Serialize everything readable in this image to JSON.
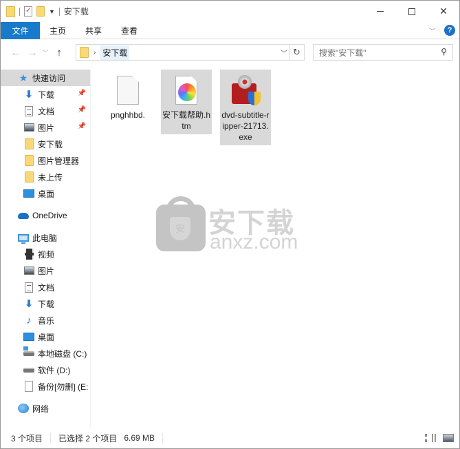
{
  "window": {
    "title": "安下载",
    "controls": [
      "minimize",
      "maximize",
      "close"
    ]
  },
  "ribbon": {
    "tabs": [
      {
        "label": "文件",
        "active": true
      },
      {
        "label": "主页"
      },
      {
        "label": "共享"
      },
      {
        "label": "查看"
      }
    ]
  },
  "navbar": {
    "breadcrumb": [
      "安下载"
    ],
    "search_placeholder": "搜索\"安下载\""
  },
  "sidebar": {
    "quick_access": {
      "label": "快速访问",
      "items": [
        {
          "label": "下载",
          "icon": "download-arrow-icon",
          "pinned": true
        },
        {
          "label": "文档",
          "icon": "document-icon",
          "pinned": true
        },
        {
          "label": "图片",
          "icon": "pictures-icon",
          "pinned": true
        },
        {
          "label": "安下载",
          "icon": "folder-icon"
        },
        {
          "label": "图片管理器",
          "icon": "folder-icon"
        },
        {
          "label": "未上传",
          "icon": "folder-icon"
        },
        {
          "label": "桌面",
          "icon": "desktop-icon"
        }
      ]
    },
    "onedrive": {
      "label": "OneDrive"
    },
    "this_pc": {
      "label": "此电脑",
      "items": [
        {
          "label": "视频",
          "icon": "video-icon"
        },
        {
          "label": "图片",
          "icon": "pictures-icon"
        },
        {
          "label": "文档",
          "icon": "document-icon"
        },
        {
          "label": "下载",
          "icon": "download-arrow-icon"
        },
        {
          "label": "音乐",
          "icon": "music-icon"
        },
        {
          "label": "桌面",
          "icon": "desktop-icon"
        },
        {
          "label": "本地磁盘 (C:)",
          "icon": "drive-c-icon"
        },
        {
          "label": "软件 (D:)",
          "icon": "drive-icon"
        },
        {
          "label": "备份[勿删] (E:",
          "icon": "blank-document-icon"
        }
      ]
    },
    "network": {
      "label": "网络"
    }
  },
  "files": [
    {
      "name": "pnghhbd.",
      "icon": "blank-file-icon",
      "selected": false
    },
    {
      "name": "安下载帮助.htm",
      "icon": "htm-file-icon",
      "selected": true
    },
    {
      "name": "dvd-subtitle-ripper-21713.exe",
      "icon": "installer-box-icon",
      "selected": true
    }
  ],
  "watermark": {
    "cn": "安下载",
    "en": "anxz.com",
    "shield_char": "安"
  },
  "statusbar": {
    "item_count": "3 个项目",
    "selected": "已选择 2 个项目",
    "size": "6.69 MB"
  }
}
